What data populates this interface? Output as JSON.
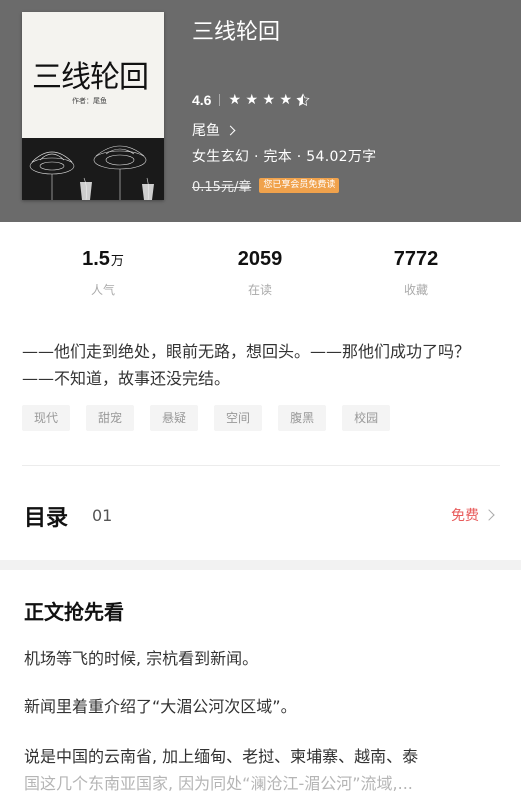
{
  "book": {
    "title": "三线轮回",
    "cover_title": "三线轮回",
    "cover_author": "作者：尾鱼",
    "rating": "4.6",
    "author_link": "尾鱼",
    "meta": "女生玄幻 · 完本 · 54.02万字",
    "price": "0.15元/章",
    "vip_badge": "您已享会员免费读",
    "rating_stars": 4.5
  },
  "stats": [
    {
      "value": "1.5",
      "unit": "万",
      "label": "人气"
    },
    {
      "value": "2059",
      "unit": "",
      "label": "在读"
    },
    {
      "value": "7772",
      "unit": "",
      "label": "收藏"
    }
  ],
  "description": "——他们走到绝处，眼前无路，想回头。——那他们成功了吗？——不知道，故事还没完结。",
  "tags": [
    "现代",
    "甜宠",
    "悬疑",
    "空间",
    "腹黑",
    "校园"
  ],
  "toc": {
    "title": "目录",
    "chapter": "01",
    "free_label": "免费"
  },
  "preview": {
    "title": "正文抢先看",
    "p1": "机场等飞的时候, 宗杭看到新闻。",
    "p2": "新闻里着重介绍了“大湄公河次区域”。",
    "p3_a": "说是中国的云南省, 加上缅甸、老挝、柬埔寨、越南、泰",
    "p3_b": "国这几个东南亚国家, 因为同处“澜沧江-湄公河”流域,..."
  },
  "colors": {
    "header_bg": "#6b6b6b",
    "vip_badge": "#f0a24c",
    "free_text": "#e85b5b"
  }
}
